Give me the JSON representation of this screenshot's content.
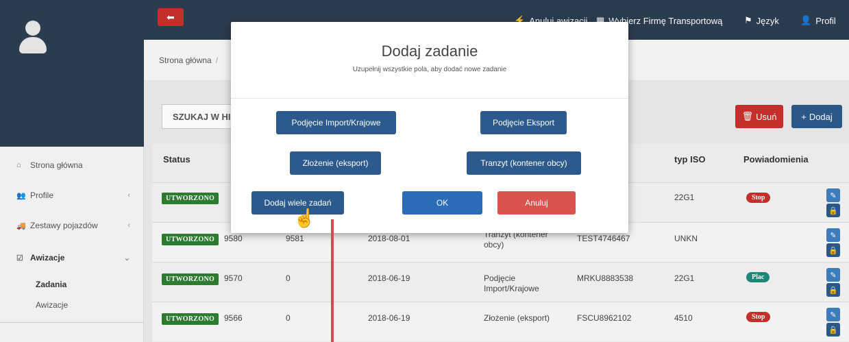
{
  "sidebar": {
    "items": [
      {
        "icon": "home-icon",
        "glyph": "⌂",
        "label": "Strona główna",
        "chevron": ""
      },
      {
        "icon": "users-icon",
        "glyph": "👥",
        "label": "Profile",
        "chevron": "‹"
      },
      {
        "icon": "truck-icon",
        "glyph": "🚚",
        "label": "Zestawy pojazdów",
        "chevron": "‹"
      },
      {
        "icon": "calendar-check-icon",
        "glyph": "☑",
        "label": "Awizacje",
        "chevron": "⌄"
      }
    ],
    "subitems": [
      {
        "label": "Zadania"
      },
      {
        "label": "Awizacje"
      }
    ]
  },
  "topbar": {
    "back_glyph": "⬅",
    "links": [
      {
        "icon_glyph": "⚡",
        "label": "Anuluj awizacji"
      },
      {
        "icon_glyph": "▦",
        "label": "Wybierz Firmę Transportową"
      },
      {
        "icon_glyph": "⚑",
        "label": "Język"
      },
      {
        "icon_glyph": "👤",
        "label": "Profil"
      }
    ]
  },
  "breadcrumb": {
    "home": "Strona główna",
    "sep": "/"
  },
  "search": {
    "label": "SZUKAJ W HI"
  },
  "actions": {
    "delete_glyph": "🗑",
    "delete_label": "Usuń",
    "add_glyph": "+",
    "add_label": "Dodaj"
  },
  "table": {
    "headers": {
      "status": "Status",
      "typ_iso": "typ ISO",
      "powiadomienia": "Powiadomienia"
    },
    "rows": [
      {
        "status": "UTWORZONO",
        "c1": "",
        "c2": "",
        "date": "",
        "type": "",
        "container": "",
        "iso": "22G1",
        "notif": "Stop"
      },
      {
        "status": "UTWORZONO",
        "c1": "9580",
        "c2": "9581",
        "date": "2018-08-01",
        "type": "Tranzyt (kontener obcy)",
        "container": "TEST4746467",
        "iso": "UNKN",
        "notif": ""
      },
      {
        "status": "UTWORZONO",
        "c1": "9570",
        "c2": "0",
        "date": "2018-06-19",
        "type": "Podjęcie Import/Krajowe",
        "container": "MRKU8883538",
        "iso": "22G1",
        "notif": "Plac"
      },
      {
        "status": "UTWORZONO",
        "c1": "9566",
        "c2": "0",
        "date": "2018-06-19",
        "type": "Złożenie (eksport)",
        "container": "FSCU8962102",
        "iso": "4510",
        "notif": "Stop"
      }
    ]
  },
  "modal": {
    "title": "Dodaj zadanie",
    "subtitle": "Uzupełnij wszystkie pola, aby dodać nowe zadanie",
    "buttons": {
      "import": "Podjęcie Import/Krajowe",
      "export": "Podjęcie Eksport",
      "zlozenie": "Złożenie (eksport)",
      "tranzyt": "Tranzyt (kontener obcy)",
      "multi": "Dodaj wiele zadań",
      "ok": "OK",
      "cancel": "Anuluj"
    }
  },
  "icons": {
    "edit": "✎",
    "lock": "🔒",
    "cursor": "☝"
  },
  "colors": {
    "navbar": "#2c3e50",
    "danger": "#c9302c",
    "primary": "#2c5a8c",
    "status_green": "#2e7d32",
    "plac": "#1d8a7a"
  }
}
